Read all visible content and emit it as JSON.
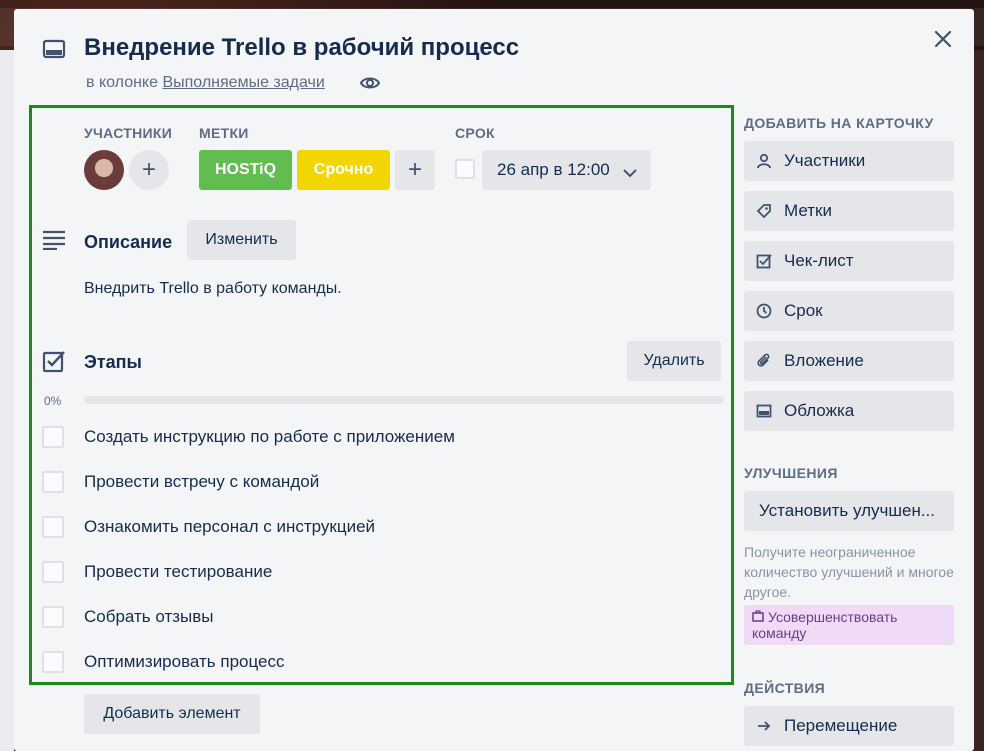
{
  "card": {
    "title": "Внедрение Trello в рабочий процесс",
    "list_prefix": "в колонке ",
    "list_name": "Выполняемые задачи"
  },
  "meta": {
    "members_label": "УЧАСТНИКИ",
    "labels_label": "МЕТКИ",
    "due_label": "СРОК",
    "labels": [
      {
        "text": "HOSTiQ",
        "color": "#61bd4f"
      },
      {
        "text": "Срочно",
        "color": "#f2d600"
      }
    ],
    "add_symbol": "+",
    "due_value": "26 апр в 12:00"
  },
  "description": {
    "title": "Описание",
    "edit_button": "Изменить",
    "text": "Внедрить Trello в работу команды."
  },
  "checklist": {
    "title": "Этапы",
    "delete_button": "Удалить",
    "progress_label": "0%",
    "progress": 0,
    "items": [
      "Создать инструкцию по работе с приложением",
      "Провести встречу с командой",
      "Ознакомить персонал с инструкцией",
      "Провести тестирование",
      "Собрать отзывы",
      "Оптимизировать процесс"
    ],
    "add_item_button": "Добавить элемент"
  },
  "sidebar": {
    "add_heading": "ДОБАВИТЬ НА КАРТОЧКУ",
    "add_buttons": [
      {
        "label": "Участники",
        "icon": "person-icon"
      },
      {
        "label": "Метки",
        "icon": "tag-icon"
      },
      {
        "label": "Чек-лист",
        "icon": "checklist-icon"
      },
      {
        "label": "Срок",
        "icon": "clock-icon"
      },
      {
        "label": "Вложение",
        "icon": "paperclip-icon"
      },
      {
        "label": "Обложка",
        "icon": "cover-icon"
      }
    ],
    "improvements_heading": "УЛУЧШЕНИЯ",
    "install_button": "Установить улучшен...",
    "improvements_note": "Получите неограниченное количество улучшений и многое другое.",
    "upgrade_button": "Усовершенствовать команду",
    "actions_heading": "ДЕЙСТВИЯ",
    "move_button": "Перемещение"
  },
  "colors": {
    "highlight_border": "#1a8a1a",
    "progress_fill": "#5ba4cf"
  }
}
